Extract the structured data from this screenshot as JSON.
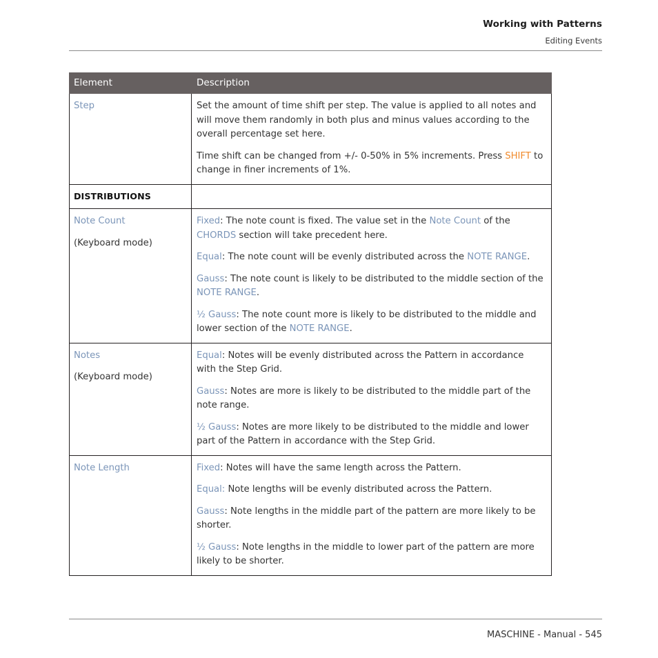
{
  "header": {
    "title": "Working with Patterns",
    "subtitle": "Editing Events"
  },
  "table": {
    "columns": [
      "Element",
      "Description"
    ],
    "rows": [
      {
        "type": "entry",
        "element": "Step",
        "element_link": true,
        "element_sub": "",
        "paragraphs": [
          {
            "segments": [
              {
                "text": "Set the amount of time shift per step. The value is applied to all notes and will move them randomly in both plus and minus values according to the overall percentage set here.",
                "style": "plain"
              }
            ]
          },
          {
            "segments": [
              {
                "text": "Time shift can be changed from +/- 0-50% in 5% increments. Press ",
                "style": "plain"
              },
              {
                "text": "SHIFT",
                "style": "kbd"
              },
              {
                "text": " to change in finer increments of 1%.",
                "style": "plain"
              }
            ]
          }
        ]
      },
      {
        "type": "section",
        "element": "DISTRIBUTIONS"
      },
      {
        "type": "entry",
        "element": "Note Count",
        "element_link": true,
        "element_sub": "(Keyboard mode)",
        "paragraphs": [
          {
            "segments": [
              {
                "text": "Fixed",
                "style": "link"
              },
              {
                "text": ": The note count is fixed. The value set in the ",
                "style": "plain"
              },
              {
                "text": "Note Count",
                "style": "link"
              },
              {
                "text": " of the ",
                "style": "plain"
              },
              {
                "text": "CHORDS",
                "style": "link"
              },
              {
                "text": " section will take precedent here.",
                "style": "plain"
              }
            ]
          },
          {
            "segments": [
              {
                "text": "Equal",
                "style": "link"
              },
              {
                "text": ": The note count will be evenly distributed across the ",
                "style": "plain"
              },
              {
                "text": "NOTE RANGE",
                "style": "link"
              },
              {
                "text": ".",
                "style": "plain"
              }
            ]
          },
          {
            "segments": [
              {
                "text": "Gauss",
                "style": "link"
              },
              {
                "text": ": The note count is likely to be distributed to the middle section of the ",
                "style": "plain"
              },
              {
                "text": "NOTE RANGE",
                "style": "link"
              },
              {
                "text": ".",
                "style": "plain"
              }
            ]
          },
          {
            "segments": [
              {
                "text": "½ Gauss",
                "style": "link"
              },
              {
                "text": ": The note count more is likely to be distributed to the middle and lower section of the ",
                "style": "plain"
              },
              {
                "text": "NOTE RANGE",
                "style": "link"
              },
              {
                "text": ".",
                "style": "plain"
              }
            ]
          }
        ]
      },
      {
        "type": "entry",
        "element": "Notes",
        "element_link": true,
        "element_sub": "(Keyboard mode)",
        "paragraphs": [
          {
            "segments": [
              {
                "text": "Equal",
                "style": "link"
              },
              {
                "text": ": Notes will be evenly distributed across the Pattern in accordance with the Step Grid.",
                "style": "plain"
              }
            ]
          },
          {
            "segments": [
              {
                "text": "Gauss",
                "style": "link"
              },
              {
                "text": ": Notes are more is likely to be distributed to the middle part of the note range.",
                "style": "plain"
              }
            ]
          },
          {
            "segments": [
              {
                "text": "½ Gauss",
                "style": "link"
              },
              {
                "text": ": Notes are more likely to be distributed to the middle and lower part of the Pattern in accordance with the Step Grid.",
                "style": "plain"
              }
            ]
          }
        ]
      },
      {
        "type": "entry",
        "element": "Note Length",
        "element_link": true,
        "element_sub": "",
        "paragraphs": [
          {
            "segments": [
              {
                "text": "Fixed",
                "style": "link"
              },
              {
                "text": ": Notes will have the same length across the Pattern.",
                "style": "plain"
              }
            ]
          },
          {
            "segments": [
              {
                "text": "Equal:",
                "style": "link"
              },
              {
                "text": " Note lengths will be evenly distributed across the Pattern.",
                "style": "plain"
              }
            ]
          },
          {
            "segments": [
              {
                "text": "Gauss",
                "style": "link"
              },
              {
                "text": ": Note lengths in the middle part of the pattern are more likely to be shorter.",
                "style": "plain"
              }
            ]
          },
          {
            "segments": [
              {
                "text": "½ Gauss",
                "style": "link"
              },
              {
                "text": ": Note lengths in the middle to lower part of the pattern are more likely to be shorter.",
                "style": "plain"
              }
            ]
          }
        ]
      }
    ]
  },
  "footer": {
    "text": "MASCHINE - Manual - 545"
  },
  "colors": {
    "link": "#7b95b8",
    "keycap": "#f0892a",
    "header_bg": "#666060",
    "body_text": "#333333",
    "rule": "#8a8a8a"
  }
}
